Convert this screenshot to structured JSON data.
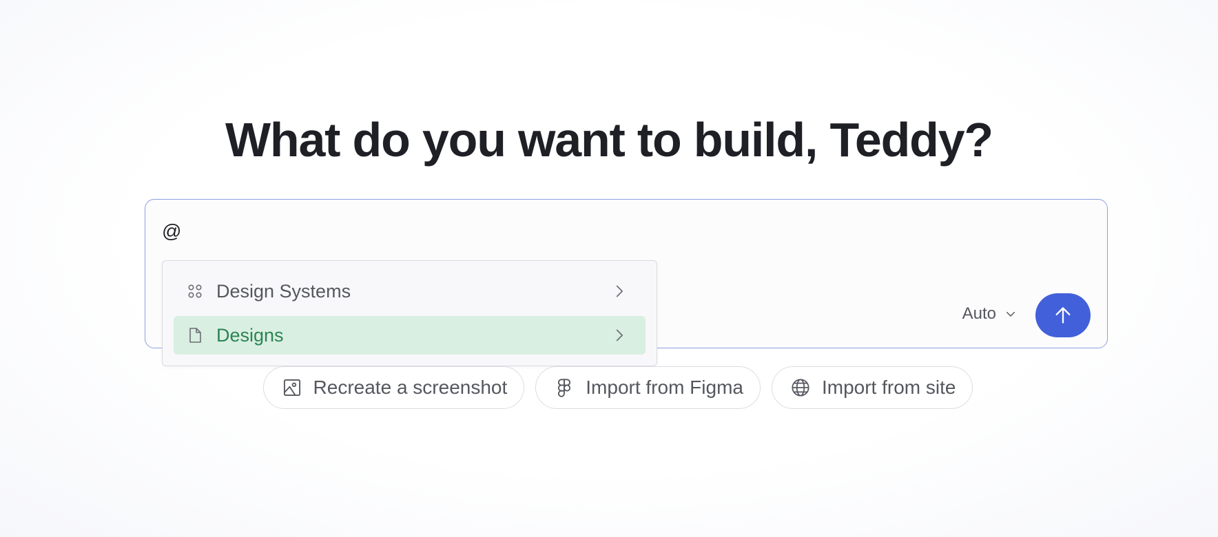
{
  "header": {
    "title": "What do you want to build, Teddy?"
  },
  "composer": {
    "value": "@",
    "model_select": {
      "selected": "Auto"
    },
    "send_icon": "arrow-up-icon",
    "accent_color": "#4260d9",
    "border_color": "#8d9fe0"
  },
  "mention_menu": {
    "items": [
      {
        "label": "Design Systems",
        "icon": "grid-dots-icon",
        "active": false
      },
      {
        "label": "Designs",
        "icon": "document-icon",
        "active": true
      }
    ],
    "active_bg": "#d9efe1",
    "active_text": "#2b8354"
  },
  "quick_actions": [
    {
      "label": "Recreate a screenshot",
      "icon": "image-icon"
    },
    {
      "label": "Import from Figma",
      "icon": "figma-icon"
    },
    {
      "label": "Import from site",
      "icon": "globe-icon"
    }
  ]
}
